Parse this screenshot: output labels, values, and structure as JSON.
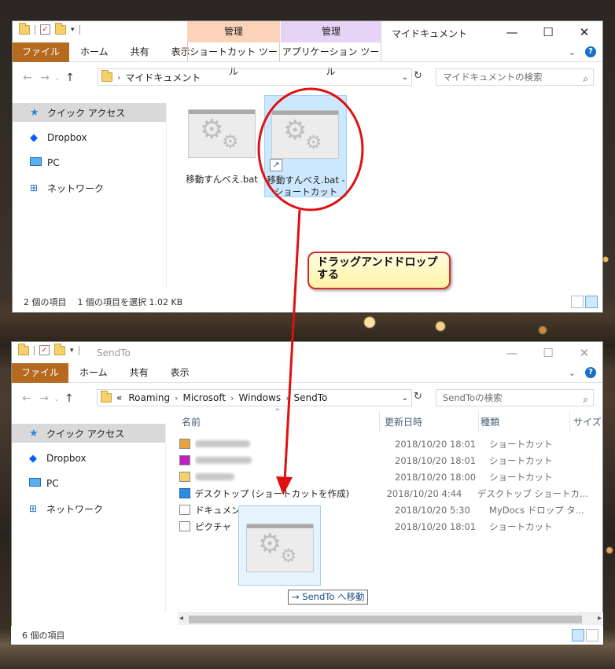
{
  "top_window": {
    "title": "マイドキュメント",
    "context_tabs": [
      {
        "header": "管理",
        "label": "ショートカット ツール",
        "color": "#fbd3b9"
      },
      {
        "header": "管理",
        "label": "アプリケーション ツール",
        "color": "#e6d3f5"
      }
    ],
    "ribbon_tabs": [
      "ファイル",
      "ホーム",
      "共有",
      "表示"
    ],
    "address": [
      "マイドキュメント"
    ],
    "search_placeholder": "マイドキュメントの検索",
    "nav": [
      "クイック アクセス",
      "Dropbox",
      "PC",
      "ネットワーク"
    ],
    "files": [
      {
        "name": "移動すんべえ.bat",
        "selected": false
      },
      {
        "name": "移動すんべえ.bat - ショートカット",
        "selected": true
      }
    ],
    "status": [
      "2 個の項目",
      "1 個の項目を選択  1.02 KB"
    ]
  },
  "callout": {
    "text": "ドラッグアンドドロップする"
  },
  "bottom_window": {
    "title": "SendTo",
    "ribbon_tabs": [
      "ファイル",
      "ホーム",
      "共有",
      "表示"
    ],
    "address": [
      "«",
      "Roaming",
      "Microsoft",
      "Windows",
      "SendTo"
    ],
    "search_placeholder": "SendToの検索",
    "nav": [
      "クイック アクセス",
      "Dropbox",
      "PC",
      "ネットワーク"
    ],
    "columns": [
      "名前",
      "更新日時",
      "種類",
      "サイズ"
    ],
    "rows": [
      {
        "name": "",
        "date": "2018/10/20 18:01",
        "type": "ショートカット"
      },
      {
        "name": "",
        "date": "2018/10/20 18:01",
        "type": "ショートカット"
      },
      {
        "name": "",
        "date": "2018/10/20 18:00",
        "type": "ショートカット"
      },
      {
        "name": "デスクトップ (ショートカットを作成)",
        "date": "2018/10/20 4:44",
        "type": "デスクトップ ショートカ..."
      },
      {
        "name": "ドキュメント",
        "date": "2018/10/20 5:30",
        "type": "MyDocs ドロップ タ..."
      },
      {
        "name": "ピクチャ",
        "date": "2018/10/20 18:01",
        "type": "ショートカット"
      }
    ],
    "drag_tip": "→ SendTo へ移動",
    "status": [
      "6 個の項目"
    ]
  },
  "colors": {
    "file_tab": "#b56a1f",
    "selection": "#cce8ff",
    "callout_border": "#d42a2a",
    "arrow": "#e01010"
  }
}
